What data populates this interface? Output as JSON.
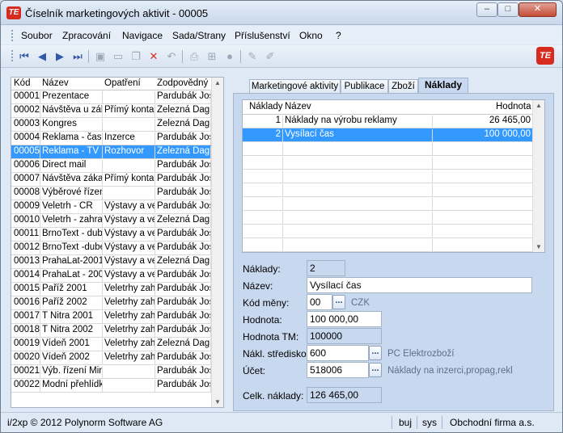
{
  "window": {
    "title": "Číselník marketingových aktivit - 00005",
    "logo": "TE",
    "controls": {
      "minimize": "–",
      "maximize": "□",
      "close": "✕"
    }
  },
  "menu": [
    "Soubor",
    "Zpracování",
    "Navigace",
    "Sada/Strany",
    "Příslušenství",
    "Okno",
    "?"
  ],
  "toolbar": {
    "icons": [
      "first-icon",
      "prev-icon",
      "next-icon",
      "last-icon",
      "save-icon",
      "new-icon",
      "copy-icon",
      "delete-icon",
      "undo-icon",
      "print-icon",
      "tree-icon",
      "stop-icon",
      "edit-icon",
      "edit-disabled-icon"
    ],
    "logo": "TE"
  },
  "list": {
    "headers": [
      "Kód",
      "Název",
      "Opatření",
      "Zodpovědný"
    ],
    "selected_index": 4,
    "rows": [
      [
        "00001",
        "Prezentace",
        "",
        "Pardubák Jos"
      ],
      [
        "00002",
        "Návštěva u zák",
        "Přímý kontak",
        "Železná Dagn"
      ],
      [
        "00003",
        "Kongres",
        "",
        "Železná Dagn"
      ],
      [
        "00004",
        "Reklama - časo",
        "Inzerce",
        "Pardubák Jos"
      ],
      [
        "00005",
        "Reklama - TV",
        "Rozhovor",
        "Železná Dagn"
      ],
      [
        "00006",
        "Direct mail",
        "",
        "Pardubák Jos"
      ],
      [
        "00007",
        "Návštěva záka:",
        "Přímý kontak",
        "Pardubák Jos"
      ],
      [
        "00008",
        "Výběrové řízeni",
        "",
        "Pardubák Jos"
      ],
      [
        "00009",
        "Veletrh - ČR",
        "Výstavy a ve",
        "Pardubák Jos"
      ],
      [
        "00010",
        "Veletrh - zahran",
        "Výstavy a ve",
        "Železná Dagn"
      ],
      [
        "00011",
        "BrnoText - dube",
        "Výstavy a ve",
        "Pardubák Jos"
      ],
      [
        "00012",
        "BrnoText -dube",
        "Výstavy a ve",
        "Pardubák Jos"
      ],
      [
        "00013",
        "PrahaLat-2001",
        "Výstavy a ve",
        "Železná Dagn"
      ],
      [
        "00014",
        "PrahaLat - 2002",
        "Výstavy a ve",
        "Pardubák Jos"
      ],
      [
        "00015",
        "Paříž 2001",
        "Veletrhy zahr",
        "Pardubák Jos"
      ],
      [
        "00016",
        "Paříž 2002",
        "Veletrhy zahr",
        "Pardubák Jos"
      ],
      [
        "00017",
        "T Nitra 2001",
        "Veletrhy zahr",
        "Pardubák Jos"
      ],
      [
        "00018",
        "T Nitra 2002",
        "Veletrhy zahr",
        "Pardubák Jos"
      ],
      [
        "00019",
        "Vídeň 2001",
        "Veletrhy zahr",
        "Železná Dagn"
      ],
      [
        "00020",
        "Vídeň 2002",
        "Veletrhy zahr",
        "Pardubák Jos"
      ],
      [
        "00021",
        "Výb. řízení Min.",
        "",
        "Pardubák Jos"
      ],
      [
        "00022",
        "Modní přehlídk.",
        "",
        "Pardubák Jos"
      ]
    ]
  },
  "tabs": [
    "Marketingové aktivity",
    "Publikace",
    "Zboží",
    "Náklady"
  ],
  "active_tab": 3,
  "costs_grid": {
    "headers": [
      "Náklady",
      "Název",
      "Hodnota"
    ],
    "selected_index": 1,
    "rows": [
      [
        "1",
        "Náklady na výrobu reklamy",
        "26 465,00"
      ],
      [
        "2",
        "Vysílací čas",
        "100 000,00"
      ]
    ]
  },
  "form": {
    "naklady_label": "Náklady:",
    "naklady_value": "2",
    "nazev_label": "Název:",
    "nazev_value": "Vysílací čas",
    "kod_meny_label": "Kód měny:",
    "kod_meny_value": "00",
    "kod_meny_hint": "CZK",
    "hodnota_label": "Hodnota:",
    "hodnota_value": "100 000,00",
    "hodnota_tm_label": "Hodnota TM:",
    "hodnota_tm_value": "100000",
    "strediska_label": "Nákl. středisko:",
    "strediska_value": "600",
    "strediska_hint": "PC Elektrozboží",
    "ucet_label": "Účet:",
    "ucet_value": "518006",
    "ucet_hint": "Náklady na inzerci,propag,rekl",
    "celk_label": "Celk. náklady:",
    "celk_value": "126 465,00",
    "dots": "..."
  },
  "status": {
    "copyright": "i/2xp © 2012 Polynorm Software AG",
    "user": "buj",
    "system": "sys",
    "company": "Obchodní firma a.s."
  }
}
